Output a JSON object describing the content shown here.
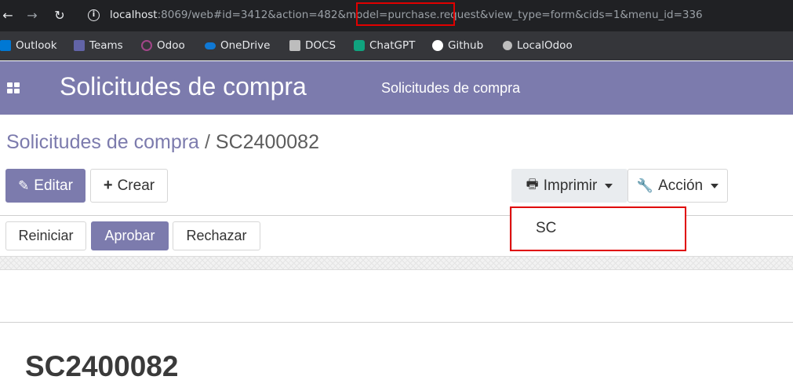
{
  "browser": {
    "url_host": "localhost",
    "url_rest": ":8069/web#id=3412&action=482&model=purchase.request&view_type=form&cids=1&menu_id=336",
    "bookmarks": [
      {
        "label": "Outlook",
        "icon": "outlook-icon",
        "color": "#0078d4"
      },
      {
        "label": "Teams",
        "icon": "teams-icon",
        "color": "#6264a7"
      },
      {
        "label": "Odoo",
        "icon": "odoo-icon",
        "color": "#a24689"
      },
      {
        "label": "OneDrive",
        "icon": "onedrive-icon",
        "color": "#0f78d4"
      },
      {
        "label": "DOCS",
        "icon": "docs-icon",
        "color": "#bdbdbd"
      },
      {
        "label": "ChatGPT",
        "icon": "chatgpt-icon",
        "color": "#10a37f"
      },
      {
        "label": "Github",
        "icon": "github-icon",
        "color": "#ffffff"
      },
      {
        "label": "LocalOdoo",
        "icon": "localodoo-icon",
        "color": "#bdbdbd"
      }
    ]
  },
  "navbar": {
    "brand": "Solicitudes de compra",
    "menu_item": "Solicitudes de compra",
    "color": "#7c7bad"
  },
  "breadcrumb": {
    "parent": "Solicitudes de compra",
    "separator": "/",
    "current": "SC2400082"
  },
  "toolbar": {
    "edit_label": "Editar",
    "create_label": "Crear",
    "print_label": "Imprimir",
    "action_label": "Acción"
  },
  "print_menu": {
    "items": [
      "SC"
    ]
  },
  "status_buttons": {
    "reset_label": "Reiniciar",
    "approve_label": "Aprobar",
    "reject_label": "Rechazar"
  },
  "record": {
    "name": "SC2400082"
  }
}
